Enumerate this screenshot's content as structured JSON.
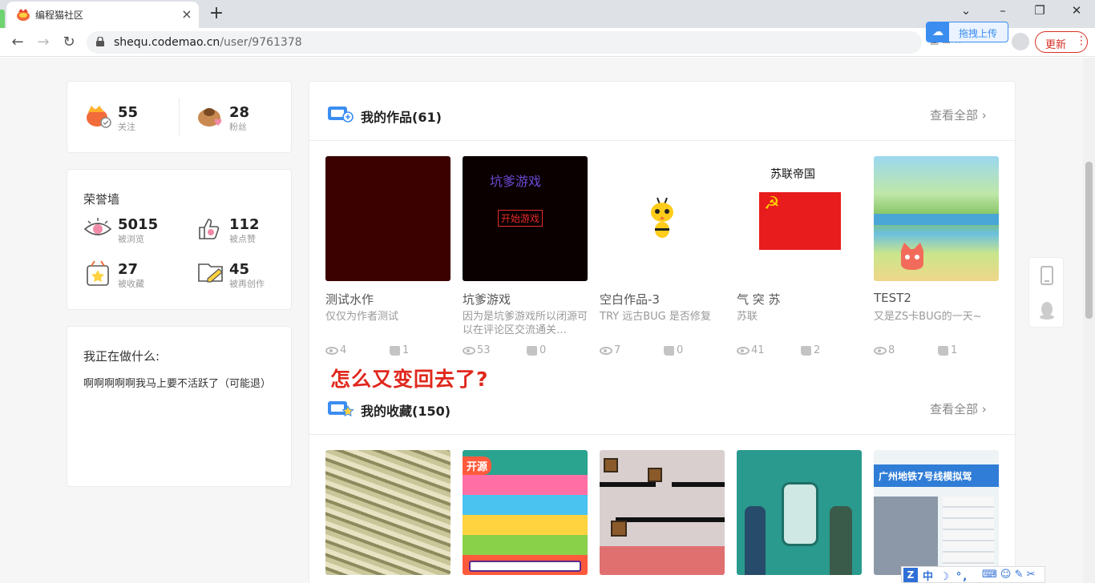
{
  "browser": {
    "tab_title": "编程猫社区",
    "url_host": "shequ.codemao.cn",
    "url_path": "/user/9761378",
    "upload_label": "拖拽上传",
    "update_label": "更新"
  },
  "colors": {
    "accent_red": "#e0281d",
    "browser_update": "#d93025",
    "upload_blue": "#3b8df0"
  },
  "follow_stats": [
    {
      "value": "55",
      "label": "关注",
      "icon": "follow-icon"
    },
    {
      "value": "28",
      "label": "粉丝",
      "icon": "fans-icon"
    }
  ],
  "honor": {
    "title": "荣誉墙",
    "items": [
      {
        "value": "5015",
        "label": "被浏览",
        "icon": "eye-icon"
      },
      {
        "value": "112",
        "label": "被点赞",
        "icon": "like-icon"
      },
      {
        "value": "27",
        "label": "被收藏",
        "icon": "star-box-icon"
      },
      {
        "value": "45",
        "label": "被再创作",
        "icon": "recreate-icon"
      }
    ]
  },
  "doing": {
    "title": "我正在做什么:",
    "text": "啊啊啊啊啊我马上要不活跃了（可能退）"
  },
  "works": {
    "title": "我的作品(61)",
    "view_all": "查看全部",
    "items": [
      {
        "title": "测试水作",
        "desc": "仅仅为作者测试",
        "views": "4",
        "likes": "1"
      },
      {
        "title": "坑爹游戏",
        "desc": "因为是坑爹游戏所以闭源可以在评论区交流通关…",
        "views": "53",
        "likes": "0",
        "thumb_text": "坑爹游戏",
        "thumb_button": "开始游戏"
      },
      {
        "title": "空白作品-3",
        "desc": "TRY 远古BUG 是否修复",
        "views": "7",
        "likes": "0"
      },
      {
        "title": "气 突 苏",
        "desc": "苏联",
        "views": "41",
        "likes": "2",
        "thumb_text": "苏联帝国"
      },
      {
        "title": "TEST2",
        "desc": "又是ZS卡BUG的一天~",
        "views": "8",
        "likes": "1"
      }
    ]
  },
  "annotation": "怎么又变回去了?",
  "collections": {
    "title": "我的收藏(150)",
    "view_all": "查看全部",
    "thumbs": [
      {
        "badge": ""
      },
      {
        "badge": "开源"
      },
      {
        "badge": ""
      },
      {
        "badge": ""
      },
      {
        "badge": "",
        "thumb_text": "广州地铁7号线模拟驾"
      }
    ]
  },
  "ime": {
    "text": "中 ☽ °,"
  }
}
